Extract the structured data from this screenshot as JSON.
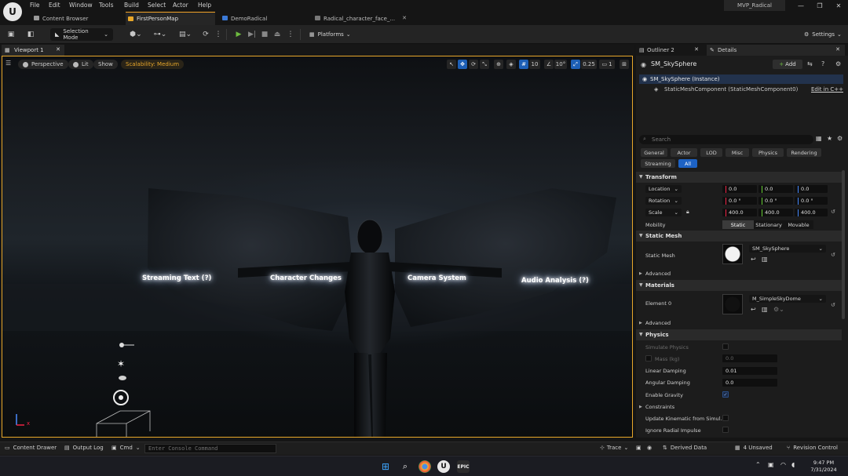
{
  "menu": [
    "File",
    "Edit",
    "Window",
    "Tools",
    "Build",
    "Select",
    "Actor",
    "Help"
  ],
  "project_name": "MVP_Radical",
  "window_controls": {
    "minimize": "—",
    "maximize": "❐",
    "close": "✕"
  },
  "doc_tabs": [
    {
      "label": "Content Browser",
      "icon": "folder-icon"
    },
    {
      "label": "FirstPersonMap",
      "icon": "level-icon",
      "active": true
    },
    {
      "label": "DemoRadical",
      "icon": "blueprint-icon"
    },
    {
      "label": "Radical_character_face_...",
      "icon": "asset-icon"
    }
  ],
  "toolbar": {
    "selection_mode": "Selection Mode",
    "platforms": "Platforms",
    "settings": "Settings"
  },
  "viewport": {
    "tab_label": "Viewport 1",
    "perspective": "Perspective",
    "lit": "Lit",
    "show": "Show",
    "scalability": "Scalability: Medium",
    "grid_snap": "10",
    "rotation_snap": "10°",
    "scale_snap": "0.25",
    "camera_speed": "1",
    "scene_labels": [
      "Streaming Text (?)",
      "Character Changes",
      "Camera System",
      "Audio Analysis (?)"
    ],
    "axis_x": "x"
  },
  "right_tabs": {
    "outliner": "Outliner 2",
    "details": "Details"
  },
  "details": {
    "actor_name": "SM_SkySphere",
    "add_label": "Add",
    "instance_row": "SM_SkySphere (Instance)",
    "component_row": "StaticMeshComponent (StaticMeshComponent0)",
    "edit_cpp": "Edit in C++",
    "search_placeholder": "Search",
    "filters": [
      "General",
      "Actor",
      "LOD",
      "Misc",
      "Physics",
      "Rendering",
      "Streaming",
      "All"
    ],
    "transform": {
      "header": "Transform",
      "location_label": "Location",
      "location": [
        "0.0",
        "0.0",
        "0.0"
      ],
      "rotation_label": "Rotation",
      "rotation": [
        "0.0 °",
        "0.0 °",
        "0.0 °"
      ],
      "scale_label": "Scale",
      "scale": [
        "400.0",
        "400.0",
        "400.0"
      ],
      "mobility_label": "Mobility",
      "mobility_options": [
        "Static",
        "Stationary",
        "Movable"
      ]
    },
    "static_mesh": {
      "header": "Static Mesh",
      "label": "Static Mesh",
      "value": "SM_SkySphere",
      "advanced": "Advanced"
    },
    "materials": {
      "header": "Materials",
      "element_label": "Element 0",
      "value": "M_SimpleSkyDome",
      "advanced": "Advanced"
    },
    "physics": {
      "header": "Physics",
      "simulate": "Simulate Physics",
      "mass_label": "Mass (kg)",
      "mass_value": "0.0",
      "linear_damping_label": "Linear Damping",
      "linear_damping": "0.01",
      "angular_damping_label": "Angular Damping",
      "angular_damping": "0.0",
      "enable_gravity": "Enable Gravity",
      "constraints": "Constraints",
      "update_kinematic": "Update Kinematic from Simul...",
      "ignore_radial": "Ignore Radial Impulse"
    }
  },
  "statusbar": {
    "content_drawer": "Content Drawer",
    "output_log": "Output Log",
    "cmd": "Cmd",
    "console_placeholder": "Enter Console Command",
    "trace": "Trace",
    "derived_data": "Derived Data",
    "unsaved": "4 Unsaved",
    "revision_control": "Revision Control"
  },
  "taskbar": {
    "time": "9:47 PM",
    "date": "7/31/2024"
  },
  "colors": {
    "accent": "#e8a72a",
    "selection": "#1d62c4"
  }
}
